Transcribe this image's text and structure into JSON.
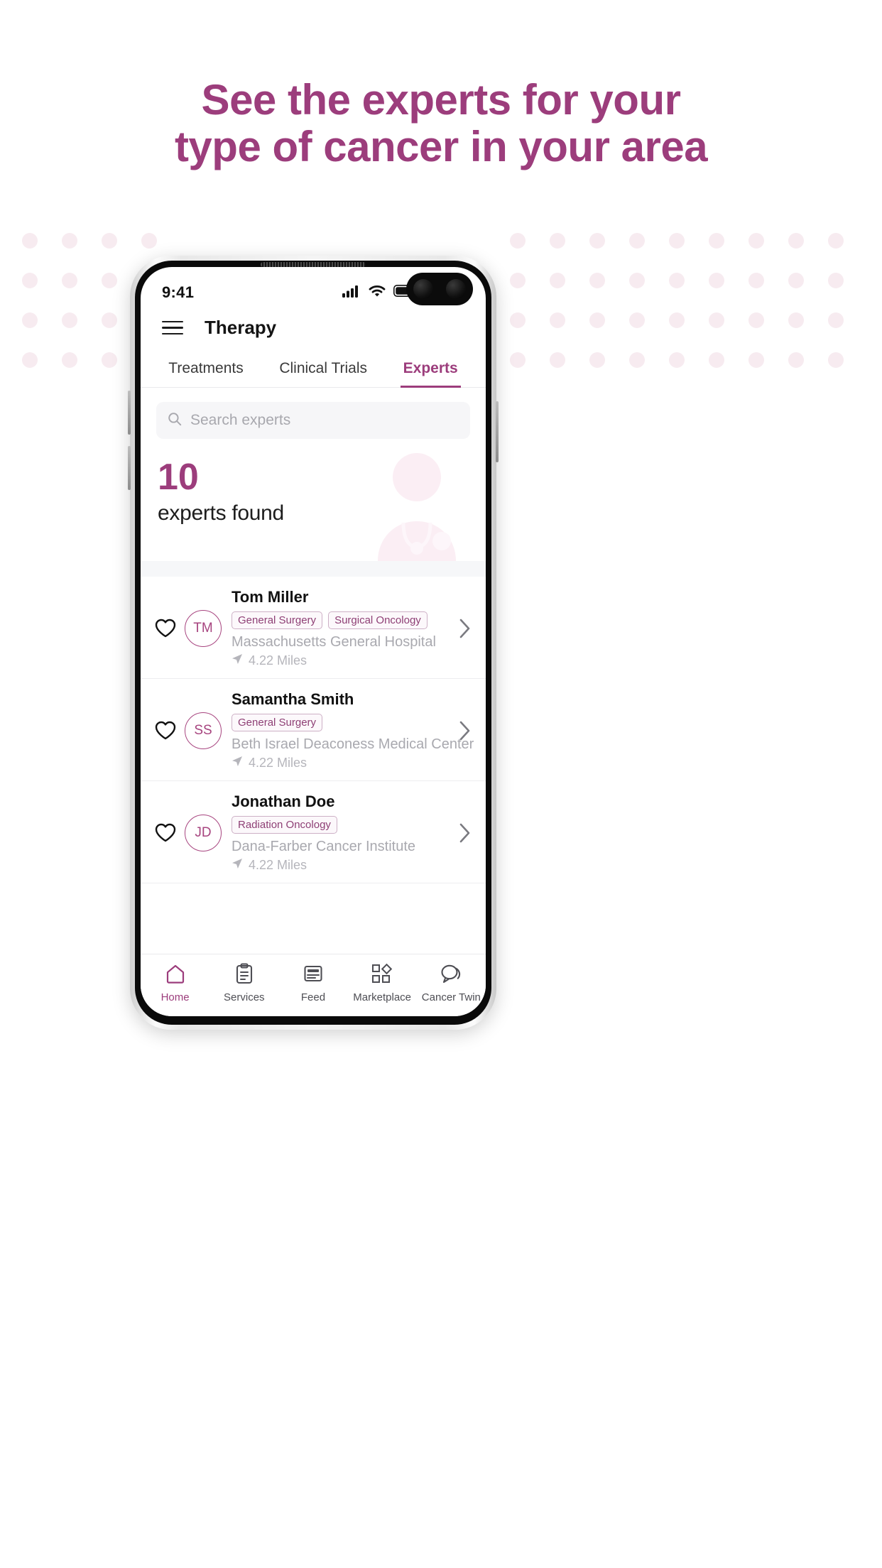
{
  "promo": {
    "headline_line1": "See the experts for your",
    "headline_line2": "type of cancer in your area",
    "headline_color": "#9c3d7c",
    "dot_color": "#f7ebf0"
  },
  "status_bar": {
    "time": "9:41",
    "signal_icon": "cellular-signal-icon",
    "wifi_icon": "wifi-icon",
    "battery_icon": "battery-full-icon"
  },
  "app": {
    "menu_icon": "hamburger-menu-icon",
    "title": "Therapy",
    "accent_color": "#9c3d7c"
  },
  "tabs": [
    {
      "label": "Treatments",
      "active": false
    },
    {
      "label": "Clinical Trials",
      "active": false
    },
    {
      "label": "Experts",
      "active": true
    }
  ],
  "search": {
    "placeholder": "Search experts",
    "value": "",
    "icon": "search-icon"
  },
  "results": {
    "count": "10",
    "label": "experts found",
    "illustration": "doctor-illustration"
  },
  "experts": [
    {
      "name": "Tom Miller",
      "initials": "TM",
      "tags": [
        "General Surgery",
        "Surgical Oncology"
      ],
      "hospital": "Massachusetts General Hospital",
      "distance": "4.22 Miles",
      "favorite_icon": "heart-outline-icon",
      "chevron_icon": "chevron-right-icon",
      "distance_icon": "navigation-arrow-icon"
    },
    {
      "name": "Samantha Smith",
      "initials": "SS",
      "tags": [
        "General Surgery"
      ],
      "hospital": "Beth Israel Deaconess Medical Center",
      "distance": "4.22 Miles",
      "favorite_icon": "heart-outline-icon",
      "chevron_icon": "chevron-right-icon",
      "distance_icon": "navigation-arrow-icon"
    },
    {
      "name": "Jonathan Doe",
      "initials": "JD",
      "tags": [
        "Radiation Oncology"
      ],
      "hospital": "Dana-Farber Cancer Institute",
      "distance": "4.22 Miles",
      "favorite_icon": "heart-outline-icon",
      "chevron_icon": "chevron-right-icon",
      "distance_icon": "navigation-arrow-icon"
    }
  ],
  "bottom_nav": [
    {
      "label": "Home",
      "icon": "home-icon",
      "active": true
    },
    {
      "label": "Services",
      "icon": "clipboard-icon",
      "active": false
    },
    {
      "label": "Feed",
      "icon": "feed-list-icon",
      "active": false
    },
    {
      "label": "Marketplace",
      "icon": "shapes-grid-icon",
      "active": false
    },
    {
      "label": "Cancer Twin",
      "icon": "chat-bubbles-icon",
      "active": false
    }
  ]
}
